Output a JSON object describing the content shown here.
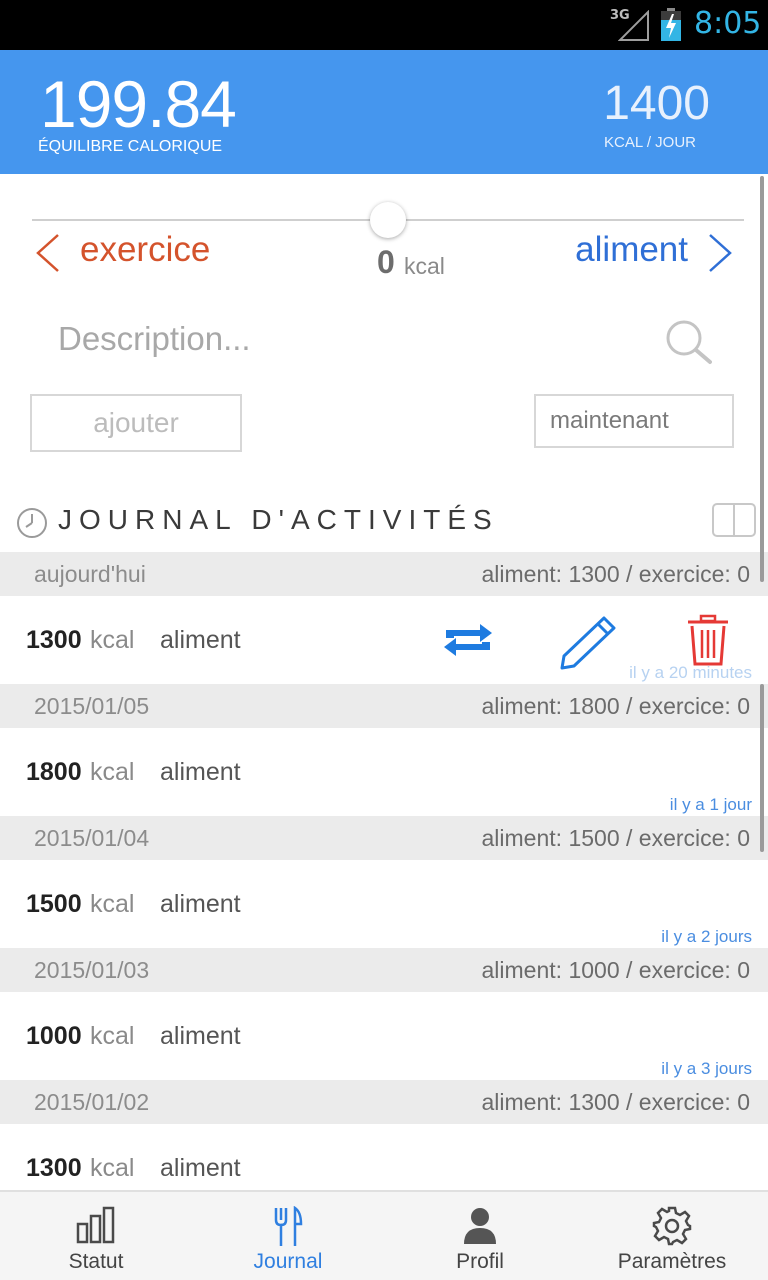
{
  "status_bar": {
    "network": "3G",
    "time": "8:05"
  },
  "header": {
    "balance_value": "199.84",
    "balance_label": "ÉQUILIBRE CALORIQUE",
    "goal_value": "1400",
    "goal_label": "KCAL / JOUR"
  },
  "entry_form": {
    "left_label": "exercice",
    "right_label": "aliment",
    "slider_value": "0",
    "slider_unit": "kcal",
    "description_placeholder": "Description...",
    "add_button": "ajouter",
    "time_field": "maintenant"
  },
  "journal": {
    "title": "JOURNAL D'ACTIVITÉS",
    "days": [
      {
        "date": "aujourd'hui",
        "summary": "aliment: 1300 / exercice: 0",
        "entries": [
          {
            "kcal": "1300",
            "unit": "kcal",
            "type": "aliment",
            "time_ago": "il y a 20 minutes"
          }
        ]
      },
      {
        "date": "2015/01/05",
        "summary": "aliment: 1800 / exercice: 0",
        "entries": [
          {
            "kcal": "1800",
            "unit": "kcal",
            "type": "aliment",
            "time_ago": "il y a 1 jour"
          }
        ]
      },
      {
        "date": "2015/01/04",
        "summary": "aliment: 1500 / exercice: 0",
        "entries": [
          {
            "kcal": "1500",
            "unit": "kcal",
            "type": "aliment",
            "time_ago": "il y a 2 jours"
          }
        ]
      },
      {
        "date": "2015/01/03",
        "summary": "aliment: 1000 / exercice: 0",
        "entries": [
          {
            "kcal": "1000",
            "unit": "kcal",
            "type": "aliment",
            "time_ago": "il y a 3 jours"
          }
        ]
      },
      {
        "date": "2015/01/02",
        "summary": "aliment: 1300 / exercice: 0",
        "entries": [
          {
            "kcal": "1300",
            "unit": "kcal",
            "type": "aliment"
          }
        ]
      }
    ]
  },
  "bottom_nav": {
    "items": [
      {
        "label": "Statut",
        "icon": "bar-chart-icon"
      },
      {
        "label": "Journal",
        "icon": "fork-knife-icon",
        "active": true
      },
      {
        "label": "Profil",
        "icon": "person-icon"
      },
      {
        "label": "Paramètres",
        "icon": "gear-icon"
      }
    ]
  },
  "colors": {
    "header_bg": "#4596ee",
    "exercise": "#d4532c",
    "food": "#2f6fd6",
    "delete": "#e53935",
    "active_nav": "#2f7fe0"
  }
}
